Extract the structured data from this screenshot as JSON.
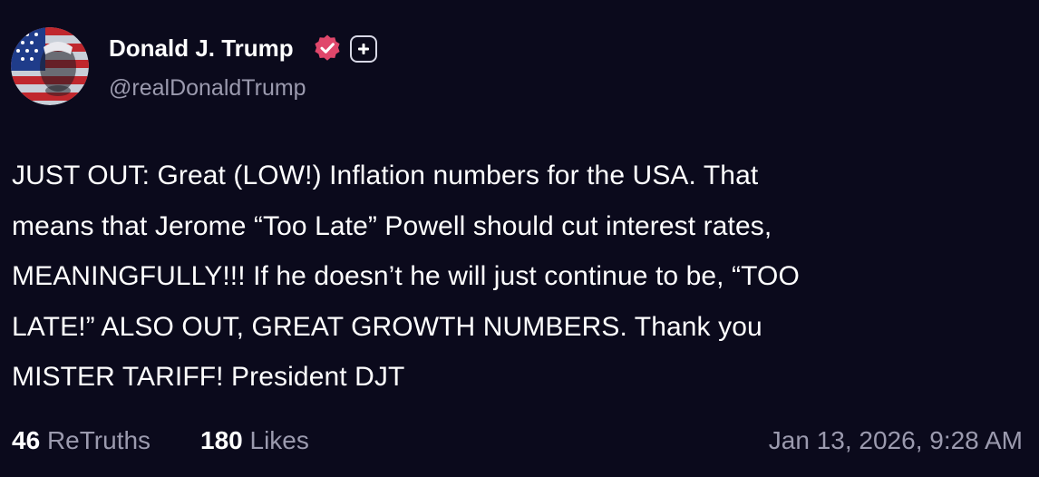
{
  "author": {
    "name": "Donald J. Trump",
    "handle": "@realDonaldTrump",
    "avatar_icon": "avatar-flag-portrait",
    "verified_icon": "verified-badge-icon",
    "verified_color": "#e0476b",
    "plus_icon": "plus-badge-icon"
  },
  "post": {
    "lines": [
      "JUST OUT: Great (LOW!) Inflation numbers for the USA. That",
      "means that Jerome “Too Late” Powell should cut interest rates,",
      "MEANINGFULLY!!! If he doesn’t he will just continue to be, “TOO",
      "LATE!” ALSO OUT, GREAT GROWTH NUMBERS. Thank you",
      "MISTER TARIFF! President DJT"
    ]
  },
  "stats": {
    "retruths_count": "46",
    "retruths_label": "ReTruths",
    "likes_count": "180",
    "likes_label": "Likes",
    "timestamp": "Jan 13, 2026, 9:28 AM"
  },
  "colors": {
    "background": "#0b0a1c",
    "text": "#ffffff",
    "muted": "#9b9aae"
  }
}
